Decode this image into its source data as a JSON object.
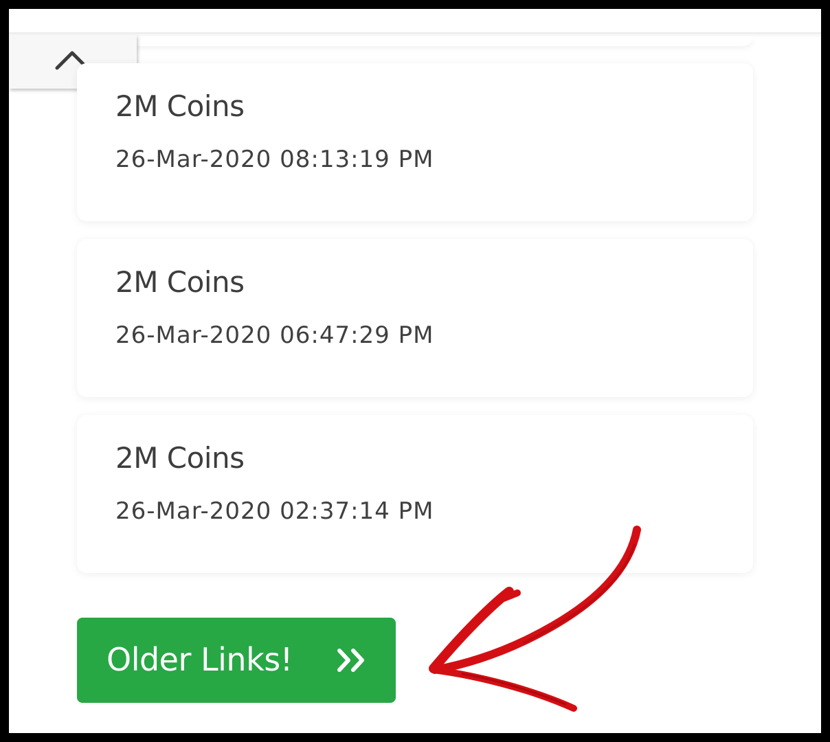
{
  "entries": [
    {
      "title": "2M Coins",
      "datetime": "26-Mar-2020 08:13:19 PM"
    },
    {
      "title": "2M Coins",
      "datetime": "26-Mar-2020 06:47:29 PM"
    },
    {
      "title": "2M Coins",
      "datetime": "26-Mar-2020 02:37:14 PM"
    }
  ],
  "older_button": {
    "label": "Older Links!",
    "icon": "double-chevron-right-icon"
  },
  "colors": {
    "button_green": "#28a745",
    "annotation_red": "#d40f14",
    "close_icon": "#1f9fb8"
  }
}
